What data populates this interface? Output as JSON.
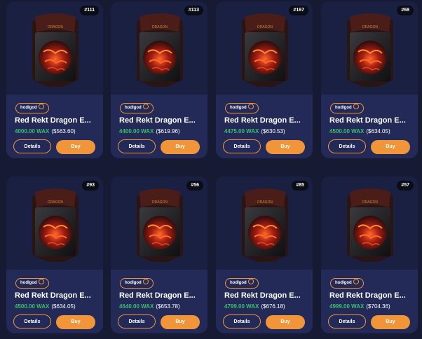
{
  "listings": [
    {
      "badge": "#111",
      "owner": "hodlgod",
      "title": "Red Rekt Dragon E...",
      "wax": "4000.00 WAX",
      "usd": "($563.60)",
      "details": "Details",
      "buy": "Buy"
    },
    {
      "badge": "#113",
      "owner": "hodlgod",
      "title": "Red Rekt Dragon E...",
      "wax": "4400.00 WAX",
      "usd": "($619.96)",
      "details": "Details",
      "buy": "Buy"
    },
    {
      "badge": "#167",
      "owner": "hodlgod",
      "title": "Red Rekt Dragon E...",
      "wax": "4475.00 WAX",
      "usd": "($630.53)",
      "details": "Details",
      "buy": "Buy"
    },
    {
      "badge": "#68",
      "owner": "hodlgod",
      "title": "Red Rekt Dragon E...",
      "wax": "4500.00 WAX",
      "usd": "($634.05)",
      "details": "Details",
      "buy": "Buy"
    },
    {
      "badge": "#93",
      "owner": "hodlgod",
      "title": "Red Rekt Dragon E...",
      "wax": "4500.00 WAX",
      "usd": "($634.05)",
      "details": "Details",
      "buy": "Buy"
    },
    {
      "badge": "#56",
      "owner": "hodlgod",
      "title": "Red Rekt Dragon E...",
      "wax": "4640.00 WAX",
      "usd": "($653.78)",
      "details": "Details",
      "buy": "Buy"
    },
    {
      "badge": "#85",
      "owner": "hodlgod",
      "title": "Red Rekt Dragon E...",
      "wax": "4799.00 WAX",
      "usd": "($676.18)",
      "details": "Details",
      "buy": "Buy"
    },
    {
      "badge": "#57",
      "owner": "hodlgod",
      "title": "Red Rekt Dragon E...",
      "wax": "4999.00 WAX",
      "usd": "($704.36)",
      "details": "Details",
      "buy": "Buy"
    }
  ],
  "colors": {
    "accent": "#f0953a",
    "price": "#3dbd73",
    "card": "#1a2042",
    "info": "#232a57",
    "page": "#161b33"
  },
  "icons": {
    "verified": "check-circle-icon"
  }
}
